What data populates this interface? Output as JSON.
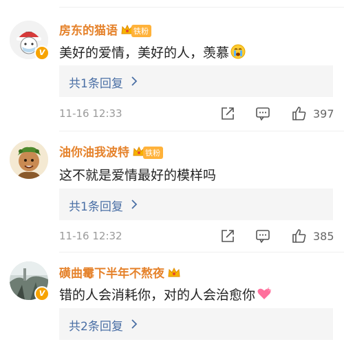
{
  "comments": [
    {
      "username": "房东的猫语",
      "fan_badge": "铁粉",
      "text": "美好的爱情，美好的人，羡慕",
      "reply": "共1条回复",
      "time": "11-16 12:33",
      "likes": "397",
      "verified": true,
      "avatar_icon": "cartoon-avatar-icon",
      "emoji_icon": "crying-emoji-icon"
    },
    {
      "username": "油你油我波特",
      "fan_badge": "铁粉",
      "text": "这不就是爱情最好的模样吗",
      "reply": "共1条回复",
      "time": "11-16 12:32",
      "likes": "385",
      "verified": false,
      "avatar_icon": "cartoon-character-avatar-icon"
    },
    {
      "username": "磺曲霉下半年不熬夜",
      "text": "错的人会消耗你，对的人会治愈你",
      "reply": "共2条回复",
      "verified": true,
      "avatar_icon": "photo-avatar-icon",
      "emoji_icon": "heart-emoji-icon"
    }
  ],
  "colors": {
    "username": "#e5822b",
    "reply_link": "#4a6fa5",
    "meta": "#9a9a9a",
    "reply_bg": "#f5f5f5",
    "fan_badge": "#ffb23a"
  }
}
